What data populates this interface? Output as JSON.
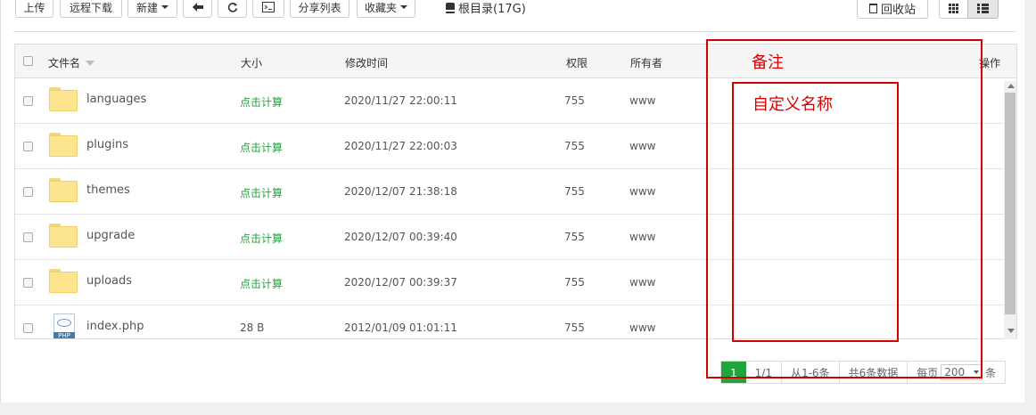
{
  "toolbar": {
    "upload": "上传",
    "remote_download": "远程下载",
    "new": "新建",
    "share_list": "分享列表",
    "favorites": "收藏夹",
    "root": "根目录(17G)",
    "recycle": "回收站"
  },
  "table": {
    "headers": {
      "name": "文件名",
      "size": "大小",
      "mtime": "修改时间",
      "perm": "权限",
      "owner": "所有者",
      "note": "备注",
      "action": "操作"
    },
    "rows": [
      {
        "name": "languages",
        "size": "点击计算",
        "mtime": "2020/11/27 22:00:11",
        "perm": "755",
        "owner": "www"
      },
      {
        "name": "plugins",
        "size": "点击计算",
        "mtime": "2020/11/27 22:00:03",
        "perm": "755",
        "owner": "www"
      },
      {
        "name": "themes",
        "size": "点击计算",
        "mtime": "2020/12/07 21:38:18",
        "perm": "755",
        "owner": "www"
      },
      {
        "name": "upgrade",
        "size": "点击计算",
        "mtime": "2020/12/07 00:39:40",
        "perm": "755",
        "owner": "www"
      },
      {
        "name": "uploads",
        "size": "点击计算",
        "mtime": "2020/12/07 00:39:37",
        "perm": "755",
        "owner": "www"
      },
      {
        "name": "index.php",
        "size": "28 B",
        "mtime": "2012/01/09 01:01:11",
        "perm": "755",
        "owner": "www"
      }
    ],
    "php_label": "PHP"
  },
  "pagination": {
    "current": "1",
    "pages": "1/1",
    "range": "从1-6条",
    "total": "共6条数据",
    "per_page_label": "每页",
    "per_page_value": "200",
    "unit": "条"
  },
  "annotations": {
    "outer_label": "备注",
    "inner_label": "自定义名称",
    "color": "#d60000"
  },
  "colors": {
    "accent": "#20a53a",
    "folder": "#fde48f"
  }
}
